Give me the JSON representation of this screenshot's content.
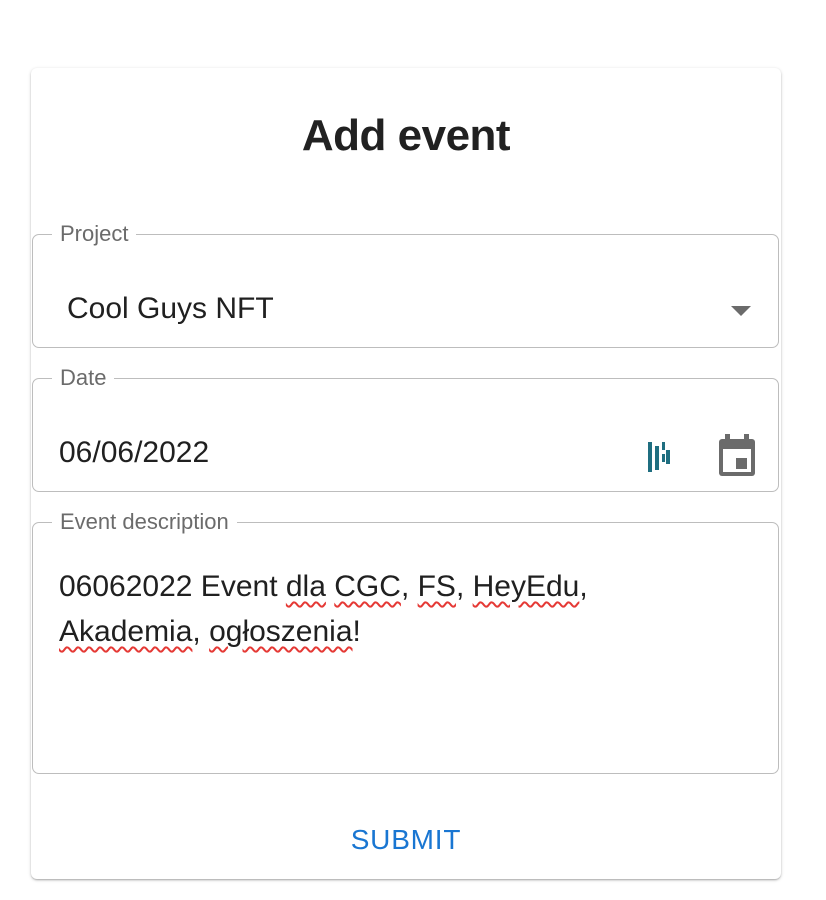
{
  "form": {
    "title": "Add event",
    "project": {
      "label": "Project",
      "value": "Cool Guys NFT"
    },
    "date": {
      "label": "Date",
      "value": "06/06/2022"
    },
    "description": {
      "label": "Event description",
      "parts": [
        "06062022 Event ",
        "dla",
        " ",
        "CGC",
        ", ",
        "FS",
        ", ",
        "HeyEdu",
        ", ",
        "Akademia",
        ", ",
        "ogłoszenia",
        "!"
      ]
    },
    "submit_label": "SUBMIT"
  },
  "colors": {
    "accent": "#1976d2",
    "border": "#bdbdbd",
    "label": "#6b6b6b",
    "text": "#202020",
    "extension_icon": "#1f6e80",
    "spellcheck": "#e53935"
  },
  "icons": {
    "project_dropdown": "chevron-down-icon",
    "date_extension": "extension-icon",
    "date_picker": "calendar-icon"
  }
}
